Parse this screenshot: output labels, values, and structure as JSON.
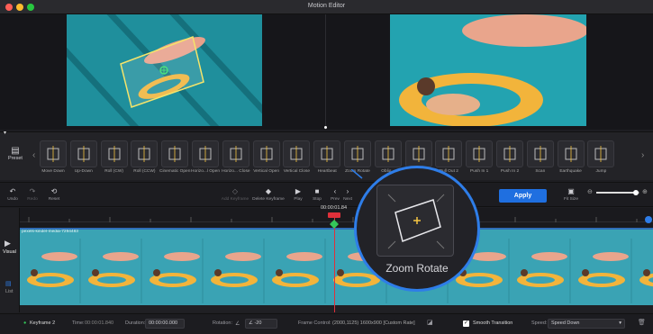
{
  "window": {
    "title": "Motion Editor"
  },
  "preset_strip": {
    "side_label": "Preset",
    "items": [
      {
        "label": "Move Down"
      },
      {
        "label": "Up-Down"
      },
      {
        "label": "Roll (CW)"
      },
      {
        "label": "Roll (CCW)"
      },
      {
        "label": "Cinematic Open"
      },
      {
        "label": "Horizo...l Open"
      },
      {
        "label": "Horizo... Close"
      },
      {
        "label": "Vertical Open"
      },
      {
        "label": "Vertical Close"
      },
      {
        "label": "Heartbeat"
      },
      {
        "label": "Zoom Rotate"
      },
      {
        "label": "Obliq..."
      },
      {
        "label": "...ll Out 1"
      },
      {
        "label": "Pull Out 2"
      },
      {
        "label": "Push In 1"
      },
      {
        "label": "Push In 2"
      },
      {
        "label": "Scan"
      },
      {
        "label": "Earthquake"
      },
      {
        "label": "Jump"
      }
    ]
  },
  "toolbar": {
    "undo": "Undo",
    "redo": "Redo",
    "reset": "Reset",
    "add_keyframe": "Add Keyframe",
    "delete_keyframe": "Delete Keyframe",
    "play": "Play",
    "stop": "Stop",
    "prev": "Prev",
    "next": "Next",
    "apply": "Apply",
    "fit_size": "Fit Size"
  },
  "timeline": {
    "timecode": "00:00:01.84",
    "track_name": "pexels-kindel-media-7294483",
    "side_visual": "Visual",
    "side_list": "List"
  },
  "lens": {
    "label": "Zoom Rotate"
  },
  "bottom": {
    "keyframe": "Keyframe 2",
    "time_label": "Time:",
    "time_value": "00:00:01.840",
    "duration_label": "Duration:",
    "duration_value": "00:00:00.000",
    "rotation_label": "Rotation:",
    "rotation_value": "-20",
    "frame_control_label": "Frame Control:",
    "frame_control_value": "(2000,1125)  1600x900  [Custom Rate]",
    "smooth_label": "Smooth Transition",
    "speed_label": "Speed:",
    "speed_value": "Speed Down"
  },
  "colors": {
    "accent": "#1f6fe0",
    "playhead": "#e0303a",
    "water": "#3aa3b4"
  }
}
